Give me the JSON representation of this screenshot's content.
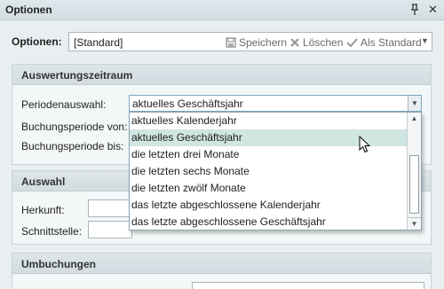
{
  "window": {
    "title": "Optionen",
    "pin_icon": "pin-icon",
    "close_icon": "close-icon"
  },
  "options": {
    "label": "Optionen:",
    "value": "[Standard]",
    "save_label": "Speichern",
    "delete_label": "Löschen",
    "default_label": "Als Standard"
  },
  "auswertung": {
    "title": "Auswertungszeitraum",
    "period_label": "Periodenauswahl:",
    "period_value": "aktuelles Geschäftsjahr",
    "from_label": "Buchungsperiode von:",
    "to_label": "Buchungsperiode bis:"
  },
  "dropdown": {
    "items": [
      "aktuelles Kalenderjahr",
      "aktuelles Geschäftsjahr",
      "die letzten drei Monate",
      "die letzten sechs Monate",
      "die letzten zwölf Monate",
      "das letzte abgeschlossene Kalenderjahr",
      "das letzte abgeschlossene Geschäftsjahr"
    ],
    "selected_index": 1
  },
  "auswahl": {
    "title": "Auswahl",
    "origin_label": "Herkunft:",
    "interface_label": "Schnittstelle:"
  },
  "umbuchungen": {
    "title": "Umbuchungen"
  },
  "colors": {
    "highlight": "#cfe6e1",
    "panel_header": "#d6e0e4",
    "background": "#e9eef0"
  }
}
